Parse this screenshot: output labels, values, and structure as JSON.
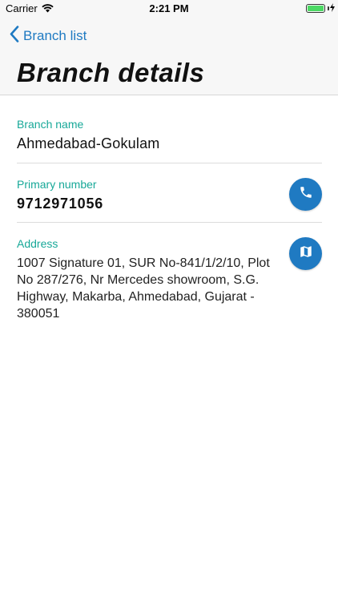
{
  "status_bar": {
    "carrier": "Carrier",
    "time": "2:21 PM",
    "battery_level": 1.0
  },
  "nav": {
    "back_label": "Branch list",
    "title": "Branch details"
  },
  "details": {
    "branch_name_label": "Branch name",
    "branch_name_value": "Ahmedabad-Gokulam",
    "primary_number_label": "Primary number",
    "primary_number_value": "9712971056",
    "address_label": "Address",
    "address_value": "1007 Signature 01, SUR No-841/1/2/10, Plot No 287/276, Nr Mercedes showroom, S.G. Highway, Makarba, Ahmedabad, Gujarat - 380051"
  },
  "actions": {
    "call_icon": "phone-icon",
    "map_icon": "map-icon"
  },
  "colors": {
    "accent": "#1f7ac2",
    "label": "#17a898",
    "battery": "#4cd964"
  }
}
